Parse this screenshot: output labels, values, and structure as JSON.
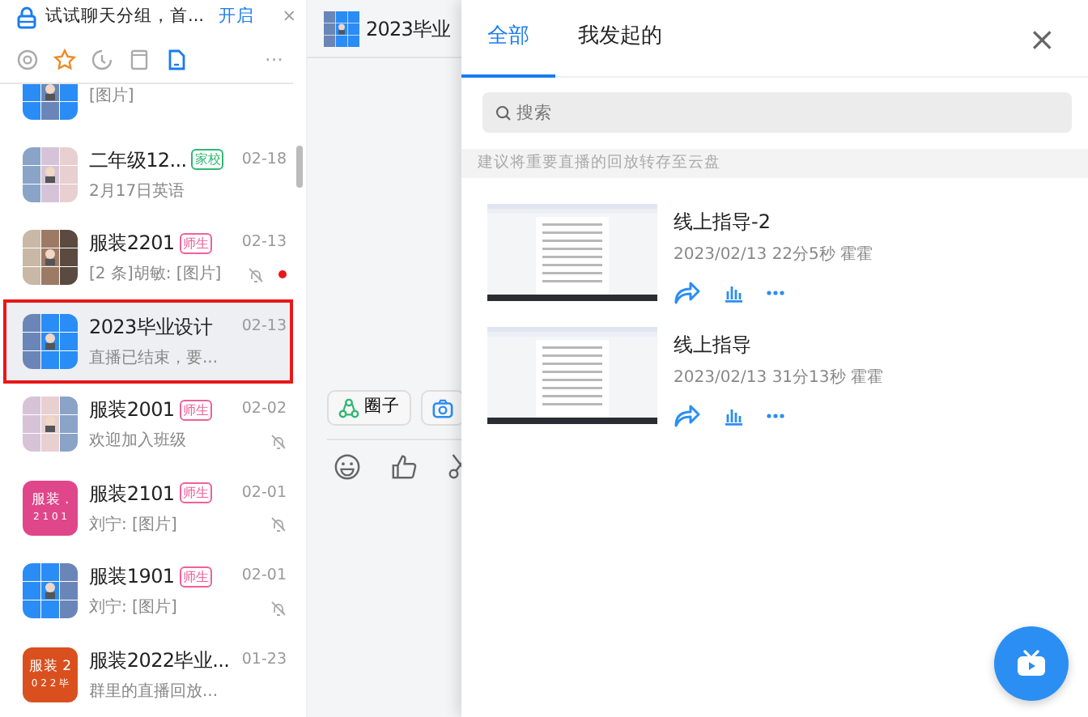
{
  "sidebar": {
    "banner": {
      "text": "试试聊天分组，首...",
      "action": "开启",
      "close": "×"
    },
    "filters": [
      {
        "kind": "mention",
        "selected": false
      },
      {
        "kind": "star",
        "selected": false
      },
      {
        "kind": "recent",
        "selected": false
      },
      {
        "kind": "doc",
        "selected": false
      },
      {
        "kind": "phone",
        "selected": true
      }
    ],
    "more": "···",
    "conversations": [
      {
        "cut": true,
        "avatar": {
          "kind": "grid"
        },
        "preview": "[图片]"
      },
      {
        "cut": false,
        "avatar": {
          "kind": "grid"
        },
        "name": "二年级12...",
        "tag": {
          "text": "家校",
          "color": "#2fb872"
        },
        "time": "02-18",
        "preview": "2月17日英语",
        "muted": false,
        "unread": false,
        "selected": false
      },
      {
        "cut": false,
        "avatar": {
          "kind": "grid"
        },
        "name": "服装2201",
        "tag": {
          "text": "师生",
          "color": "#f0609a"
        },
        "time": "02-13",
        "preview": "[2 条]胡敏: [图片]",
        "muted": true,
        "unread": true,
        "selected": false
      },
      {
        "cut": false,
        "avatar": {
          "kind": "grid"
        },
        "name": "2023毕业设计",
        "time": "02-13",
        "preview": "直播已结束，要...",
        "muted": false,
        "unread": false,
        "selected": true
      },
      {
        "cut": false,
        "avatar": {
          "kind": "grid"
        },
        "name": "服装2001",
        "tag": {
          "text": "师生",
          "color": "#f0609a"
        },
        "time": "02-02",
        "preview": "欢迎加入班级",
        "muted": true,
        "unread": false,
        "selected": false
      },
      {
        "cut": false,
        "avatar": {
          "kind": "text",
          "color": "#e0468a",
          "lines": [
            "服装 .",
            "2 1 0 1"
          ]
        },
        "name": "服装2101",
        "tag": {
          "text": "师生",
          "color": "#f0609a"
        },
        "time": "02-01",
        "preview": "刘宁: [图片]",
        "muted": true,
        "unread": false,
        "selected": false
      },
      {
        "cut": false,
        "avatar": {
          "kind": "grid"
        },
        "name": "服装1901",
        "tag": {
          "text": "师生",
          "color": "#f0609a"
        },
        "time": "02-01",
        "preview": "刘宁: [图片]",
        "muted": true,
        "unread": false,
        "selected": false
      },
      {
        "cut": false,
        "avatar": {
          "kind": "text",
          "color": "#d9501e",
          "lines": [
            "服装 2",
            "0 2 2 毕"
          ]
        },
        "name": "服装2022毕业...",
        "time": "01-23",
        "preview": "群里的直播回放...",
        "muted": false,
        "unread": false,
        "selected": false
      }
    ]
  },
  "chat": {
    "title": "2023毕业",
    "chips": [
      {
        "kind": "circle",
        "label": "圈子"
      },
      {
        "kind": "camera"
      }
    ]
  },
  "drawer": {
    "tabs": [
      {
        "label": "全部",
        "selected": true
      },
      {
        "label": "我发起的",
        "selected": false
      }
    ],
    "close": "×",
    "search": {
      "placeholder": "搜索"
    },
    "notice": "建议将重要直播的回放转存至云盘",
    "recordings": [
      {
        "title": "线上指导-2",
        "meta": "2023/02/13 22分5秒 霍霍"
      },
      {
        "title": "线上指导",
        "meta": "2023/02/13 31分13秒 霍霍"
      }
    ]
  }
}
